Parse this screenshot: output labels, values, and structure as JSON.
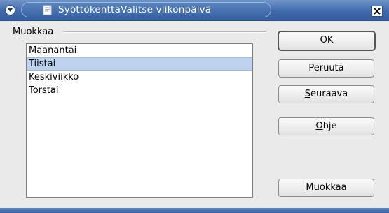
{
  "window": {
    "title": "SyöttökenttäValitse viikonpäivä"
  },
  "group": {
    "label": "Muokkaa"
  },
  "list": {
    "items": [
      {
        "label": "Maanantai",
        "selected": false
      },
      {
        "label": "Tiistai",
        "selected": true
      },
      {
        "label": "Keskiviikko",
        "selected": false
      },
      {
        "label": "Torstai",
        "selected": false
      }
    ]
  },
  "buttons": {
    "ok": {
      "label": "OK"
    },
    "cancel": {
      "label": "Peruuta"
    },
    "next": {
      "mnemonic": "S",
      "rest": "euraava"
    },
    "help": {
      "mnemonic": "O",
      "rest": "hje"
    },
    "edit": {
      "mnemonic": "M",
      "rest": "uokkaa"
    }
  },
  "colors": {
    "titlebar": "#3f6aab",
    "selection": "#bdd3ef"
  }
}
